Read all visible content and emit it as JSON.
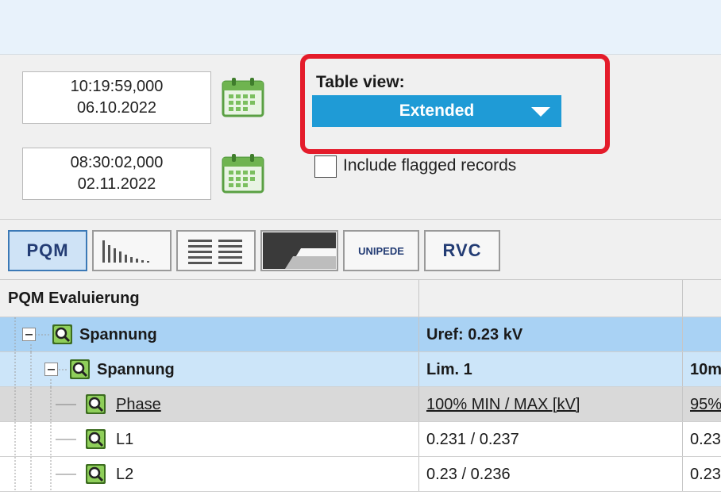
{
  "start": {
    "time": "10:19:59,000",
    "date": "06.10.2022"
  },
  "end": {
    "time": "08:30:02,000",
    "date": "02.11.2022"
  },
  "icons": {
    "calendar": "calendar-icon",
    "node": "magnifier-icon",
    "expand": "collapse-minus-icon",
    "dropdown": "chevron-down-icon"
  },
  "table_view": {
    "label": "Table view:",
    "selected": "Extended"
  },
  "include_flagged": {
    "label": "Include flagged records",
    "checked": false
  },
  "toolbar": {
    "buttons": [
      {
        "name": "PQM",
        "active": true
      },
      {
        "name": "histogram",
        "active": false
      },
      {
        "name": "list",
        "active": false
      },
      {
        "name": "profile",
        "active": false
      },
      {
        "name": "UNIPEDE",
        "active": false
      },
      {
        "name": "RVC",
        "active": false
      }
    ]
  },
  "colors": {
    "accent": "#1f9bd6",
    "highlight": "#e41c2b",
    "row_selected": "#a9d2f4",
    "row_light": "#cce5f9",
    "row_gray": "#d9d9d9"
  },
  "grid": {
    "header": {
      "col1": "PQM Evaluierung",
      "col2": "",
      "col3": ""
    },
    "rows": [
      {
        "label": "Spannung",
        "col2": "Uref: 0.23 kV",
        "col3": ""
      },
      {
        "label": "Spannung",
        "col2": "Lim. 1",
        "col3": "10m"
      },
      {
        "label": "Phase",
        "col2": "100% MIN / MAX [kV]",
        "col3": "95%"
      },
      {
        "label": "L1",
        "col2": "0.231 / 0.237",
        "col3": "0.23"
      },
      {
        "label": "L2",
        "col2": "0.23 / 0.236",
        "col3": "0.23"
      }
    ]
  }
}
